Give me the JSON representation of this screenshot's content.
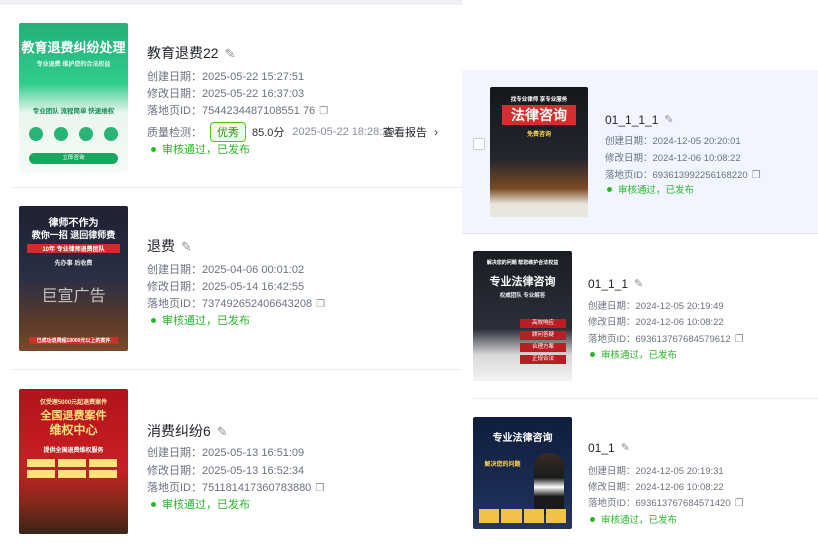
{
  "left_cards": [
    {
      "title": "教育退费22",
      "created": "创建日期：2025-05-22 15:27:51",
      "modified": "修改日期：2025-05-22 16:37:03",
      "landing_id": "落地页ID：7544234487108551 76",
      "quality_label": "质量检测：",
      "quality_badge": "优秀",
      "quality_score": "85.0分",
      "quality_date": "2025-05-22 18:28:20",
      "report_label": "查看报告",
      "status": "审核通过，已发布",
      "thumb": {
        "line1": "教育退费纠纷处理",
        "line2": "专业退费 维护您的合法权益",
        "line3": "专业团队 流程简单 快速维权",
        "button": "立即咨询"
      }
    },
    {
      "title": "退费",
      "created": "创建日期：2025-04-06 00:01:02",
      "modified": "修改日期：2025-05-14 16:42:55",
      "landing_id": "落地页ID：737492652406643208",
      "status": "审核通过，已发布",
      "thumb": {
        "line1": "律师不作为",
        "line2": "教你一招 退回律师费",
        "line3": "10年 专业律师退费团队",
        "line4": "先办事 后收费",
        "line5": "巨宣广告",
        "line6": "已成功退费超10000元以上的案件"
      }
    },
    {
      "title": "消费纠纷6",
      "created": "创建日期：2025-05-13 16:51:09",
      "modified": "修改日期：2025-05-13 16:52:34",
      "landing_id": "落地页ID：751181417360783880",
      "status": "审核通过，已发布",
      "thumb": {
        "line1": "仅受理5000元起退费案件",
        "line2": "全国退费案件",
        "line3": "维权中心",
        "line4": "提供全国退费维权服务"
      }
    }
  ],
  "right_cards": [
    {
      "title": "01_1_1_1",
      "created": "创建日期：2024-12-05 20:20:01",
      "modified": "修改日期：2024-12-06 10:08:22",
      "landing_id": "落地页ID：693613992256168220",
      "status": "审核通过，已发布",
      "thumb": {
        "line1": "找专业律师 享专业服务",
        "line2": "法律咨询",
        "line3": "免费咨询"
      }
    },
    {
      "title": "01_1_1",
      "created": "创建日期：2024-12-05 20:19:49",
      "modified": "修改日期：2024-12-06 10:08:22",
      "landing_id": "落地页ID：693613767684579612",
      "status": "审核通过，已发布",
      "thumb": {
        "line1": "解决您的问题 帮您维护合法权益",
        "line2": "专业法律咨询",
        "line3": "权威团队 专业解答",
        "items": [
          "高效响应",
          "顾问答疑",
          "合理方案",
          "正规合法"
        ]
      }
    },
    {
      "title": "01_1",
      "created": "创建日期：2024-12-05 20:19:31",
      "modified": "修改日期：2024-12-06 10:08:22",
      "landing_id": "落地页ID：693613767684571420",
      "status": "审核通过，已发布",
      "thumb": {
        "line1": "专业法律咨询",
        "line2": "解决您的问题"
      }
    }
  ]
}
